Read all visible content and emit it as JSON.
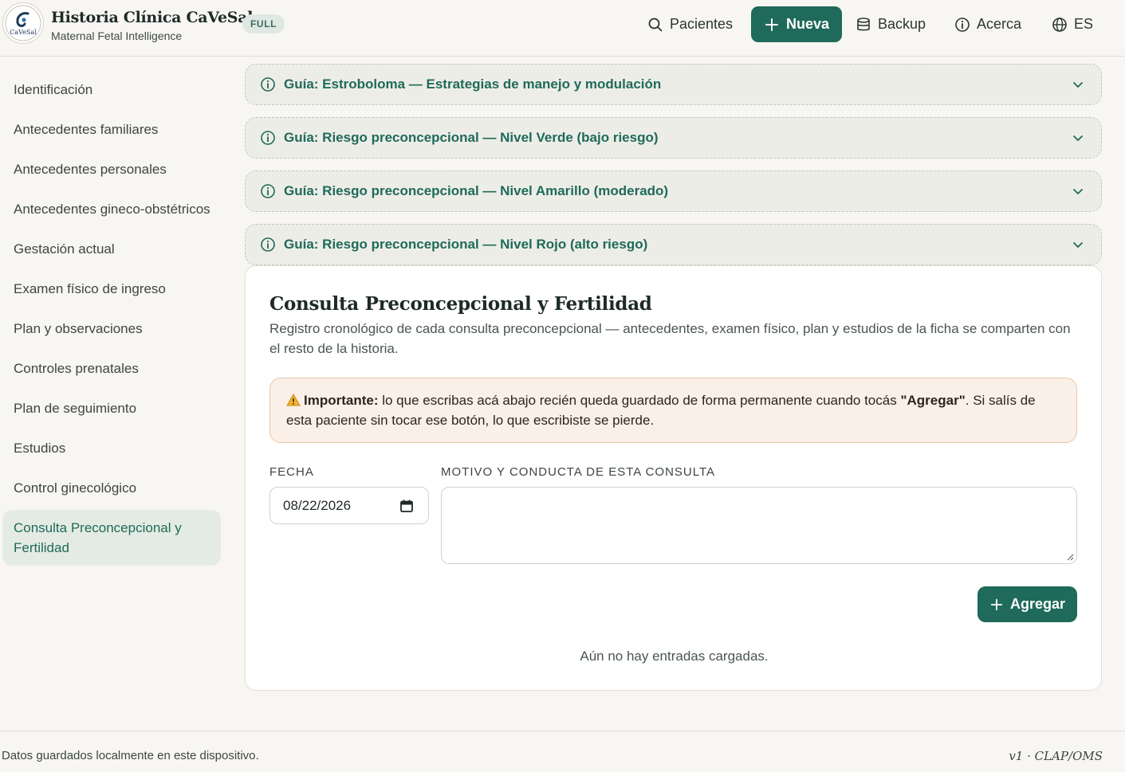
{
  "header": {
    "logo_text": "CaVeSal",
    "brand_title": "Historia Clínica CaVeSal",
    "brand_subtitle": "Maternal Fetal Intelligence",
    "badge": "FULL",
    "nav": {
      "patients": "Pacientes",
      "new": "Nueva",
      "backup": "Backup",
      "about": "Acerca",
      "lang": "ES"
    }
  },
  "sidebar": {
    "items": [
      {
        "label": "Identificación"
      },
      {
        "label": "Antecedentes familiares"
      },
      {
        "label": "Antecedentes personales"
      },
      {
        "label": "Antecedentes gineco-obstétricos"
      },
      {
        "label": "Gestación actual"
      },
      {
        "label": "Examen físico de ingreso"
      },
      {
        "label": "Plan y observaciones"
      },
      {
        "label": "Controles prenatales"
      },
      {
        "label": "Plan de seguimiento"
      },
      {
        "label": "Estudios"
      },
      {
        "label": "Control ginecológico"
      },
      {
        "label": "Consulta Preconcepcional y Fertilidad"
      }
    ]
  },
  "guides": [
    {
      "label": "Guía: Estroboloma — Estrategias de manejo y modulación"
    },
    {
      "label": "Guía: Riesgo preconcepcional — Nivel Verde (bajo riesgo)"
    },
    {
      "label": "Guía: Riesgo preconcepcional — Nivel Amarillo (moderado)"
    },
    {
      "label": "Guía: Riesgo preconcepcional — Nivel Rojo (alto riesgo)"
    }
  ],
  "card": {
    "title": "Consulta Preconcepcional y Fertilidad",
    "description": "Registro cronológico de cada consulta preconcepcional — antecedentes, examen físico, plan y estudios de la ficha se comparten con el resto de la historia.",
    "warning": {
      "strong": "Importante:",
      "text_before": " lo que escribas acá abajo recién queda guardado de forma permanente cuando tocás ",
      "highlight": "\"Agregar\"",
      "text_after": ". Si salís de esta paciente sin tocar ese botón, lo que escribiste se pierde."
    },
    "date_label": "FECHA",
    "date_value": "08/22/2026",
    "reason_label": "MOTIVO Y CONDUCTA DE ESTA CONSULTA",
    "reason_value": "",
    "add_button": "Agregar",
    "empty_text": "Aún no hay entradas cargadas."
  },
  "footer": {
    "left": "Datos guardados localmente en este dispositivo.",
    "right": "v1 · CLAP/OMS"
  },
  "colors": {
    "accent": "#1f6a5a",
    "background": "#f8f6f2",
    "warning_bg": "#fbf0e8"
  }
}
